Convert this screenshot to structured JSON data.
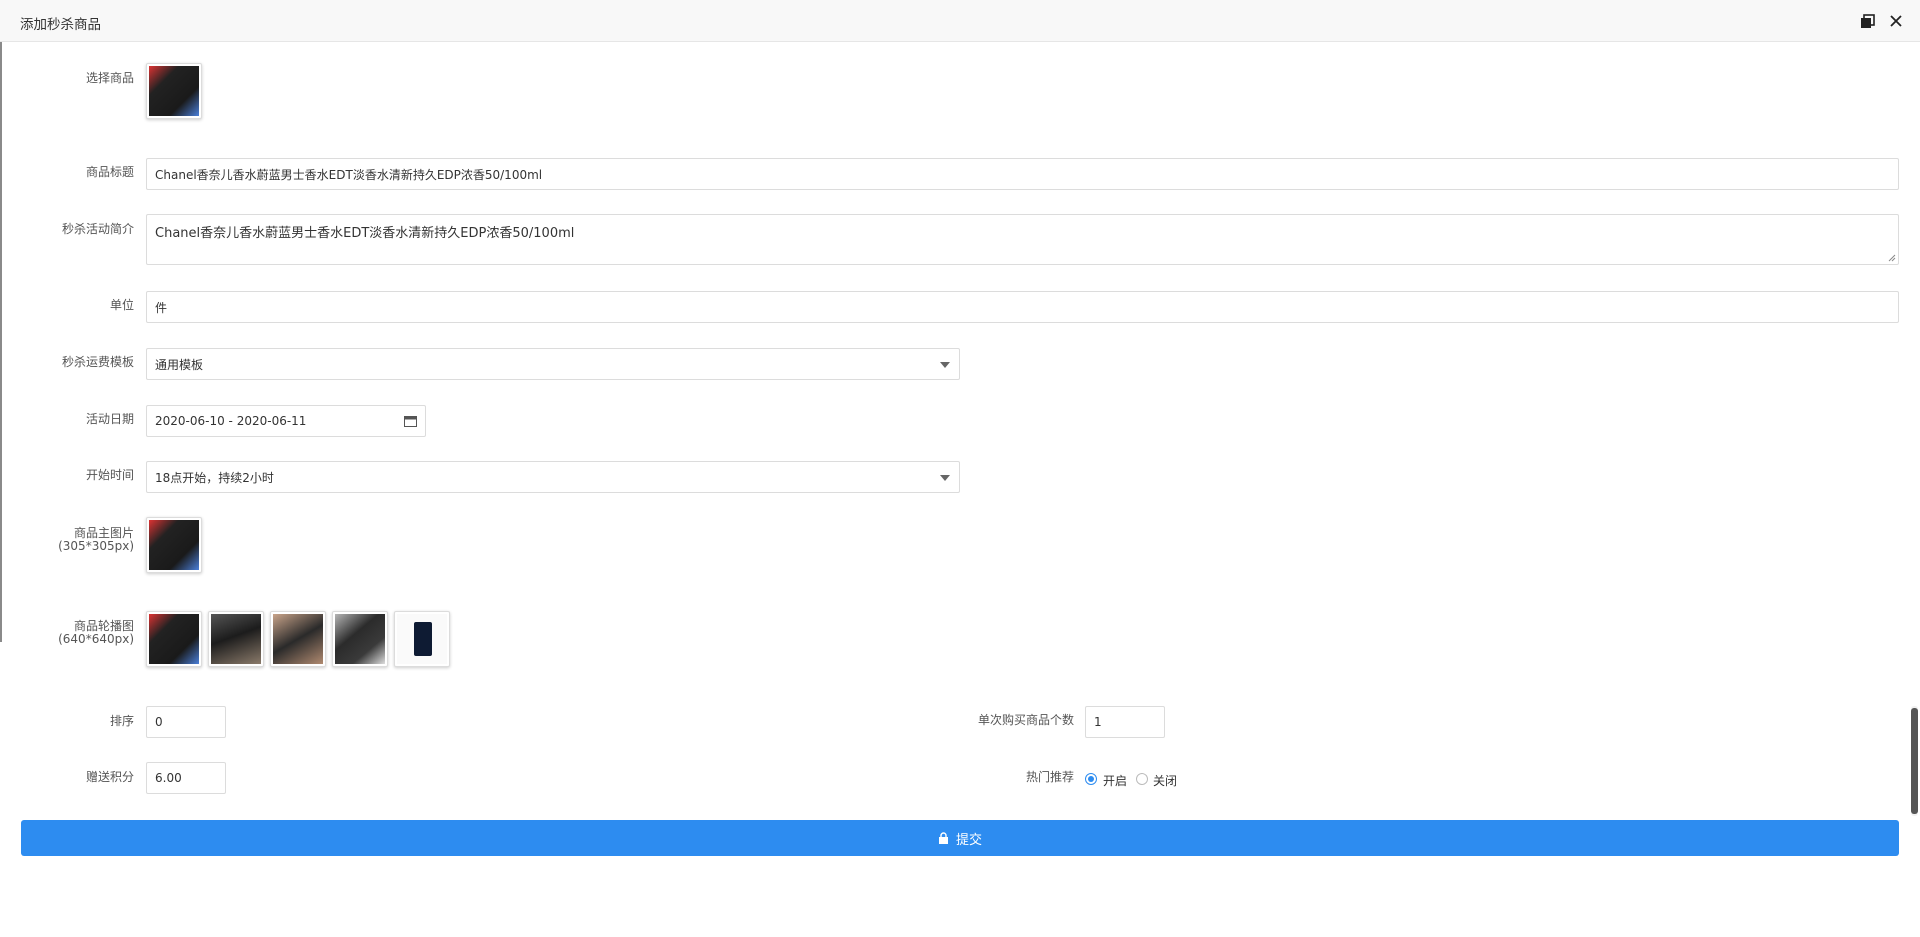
{
  "header": {
    "title": "添加秒杀商品"
  },
  "form": {
    "select_goods_label": "选择商品",
    "title_label": "商品标题",
    "title_value": "Chanel香奈儿香水蔚蓝男士香水EDT淡香水清新持久EDP浓香50/100ml",
    "intro_label": "秒杀活动简介",
    "intro_value": "Chanel香奈儿香水蔚蓝男士香水EDT淡香水清新持久EDP浓香50/100ml",
    "unit_label": "单位",
    "unit_value": "件",
    "shipping_label": "秒杀运费模板",
    "shipping_value": "通用模板",
    "date_label": "活动日期",
    "date_value": "2020-06-10 - 2020-06-11",
    "time_label": "开始时间",
    "time_value": "18点开始，持续2小时",
    "main_image_label": "商品主图片",
    "main_image_size": "(305*305px)",
    "carousel_label": "商品轮播图",
    "carousel_size": "(640*640px)",
    "sort_label": "排序",
    "sort_value": "0",
    "max_buy_label": "单次购买商品个数",
    "max_buy_value": "1",
    "points_label": "赠送积分",
    "points_value": "6.00",
    "hot_label": "热门推荐",
    "hot_on_label": "开启",
    "hot_off_label": "关闭",
    "hot_selected": "开启",
    "submit_label": "提交"
  },
  "colors": {
    "primary": "#2d8cf0",
    "header_bg": "#f8f8f8"
  },
  "icons": {
    "header": [
      "restore-icon",
      "close-icon"
    ],
    "date": "calendar-icon",
    "submit": "lock-icon"
  }
}
